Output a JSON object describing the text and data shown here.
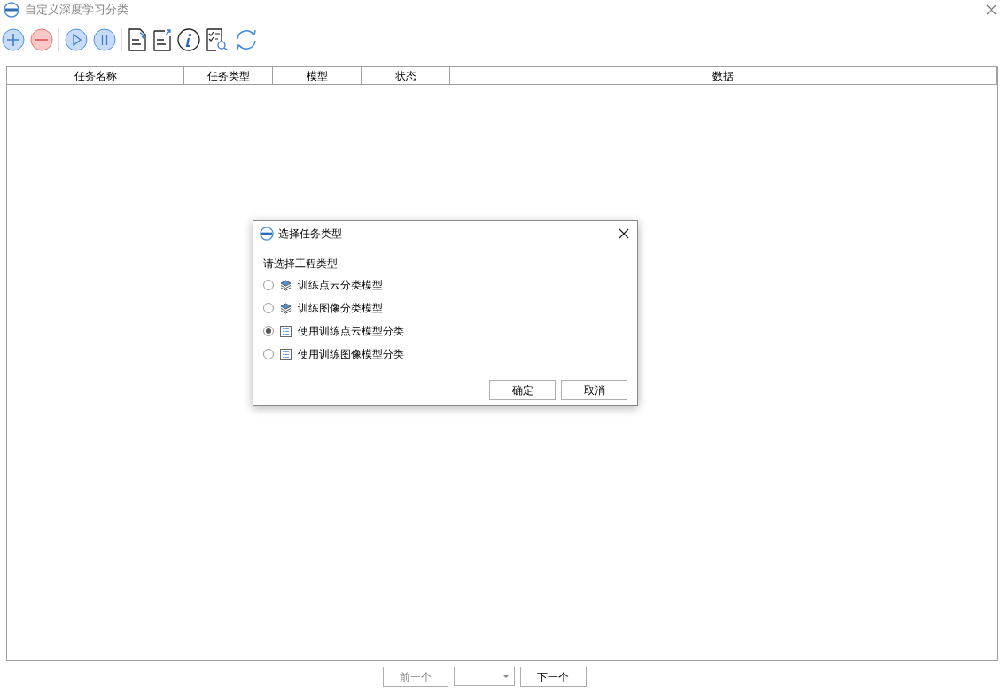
{
  "window": {
    "title": "自定义深度学习分类"
  },
  "toolbar": [
    {
      "kind": "add"
    },
    {
      "kind": "remove"
    },
    {
      "kind": "sep"
    },
    {
      "kind": "play"
    },
    {
      "kind": "pause"
    },
    {
      "kind": "sep"
    },
    {
      "kind": "import"
    },
    {
      "kind": "export"
    },
    {
      "kind": "info"
    },
    {
      "kind": "inspect"
    },
    {
      "kind": "refresh"
    }
  ],
  "table": {
    "columns": [
      "任务名称",
      "任务类型",
      "模型",
      "状态",
      "数据"
    ]
  },
  "dialog": {
    "title": "选择任务类型",
    "prompt": "请选择工程类型",
    "options": [
      {
        "label": "训练点云分类模型",
        "kind": "layers",
        "selected": false
      },
      {
        "label": "训练图像分类模型",
        "kind": "layers",
        "selected": false
      },
      {
        "label": "使用训练点云模型分类",
        "kind": "list",
        "selected": true
      },
      {
        "label": "使用训练图像模型分类",
        "kind": "list",
        "selected": false
      }
    ],
    "buttons": [
      "确定",
      "取消"
    ]
  },
  "pager": {
    "prev": {
      "label": "前一个",
      "disabled": true
    },
    "next": {
      "label": "下一个",
      "disabled": false
    }
  }
}
